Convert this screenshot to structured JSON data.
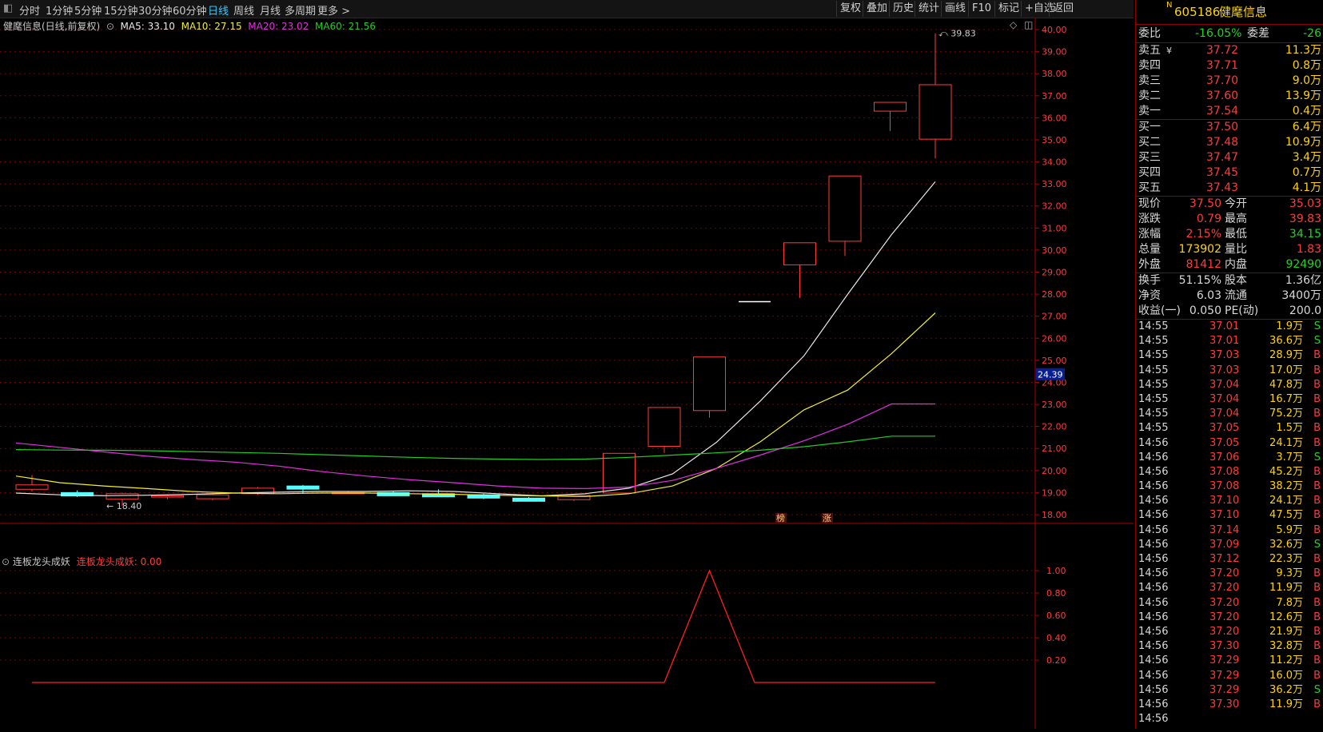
{
  "toolbar": {
    "periods": [
      "分时",
      "1分钟",
      "5分钟",
      "15分钟",
      "30分钟",
      "60分钟",
      "日线",
      "周线",
      "月线",
      "多周期",
      "更多 >"
    ],
    "active_period": "日线",
    "buttons": [
      "复权",
      "叠加",
      "历史",
      "统计",
      "画线",
      "F10",
      "标记",
      "+自选",
      "返回"
    ]
  },
  "main_legend": {
    "title": "健麾信息(日线,前复权)",
    "ma5": "MA5: 33.10",
    "ma10": "MA10: 27.15",
    "ma20": "MA20: 23.02",
    "ma60": "MA60: 21.56"
  },
  "colors": {
    "up": "#ff3b3b",
    "down": "#54ffff",
    "ma5": "#e8e8e8",
    "ma10": "#f2ee32",
    "ma20": "#e030e0",
    "ma60": "#22cc22",
    "grid": "#7a0000"
  },
  "price_axis": {
    "labels": [
      "40.00",
      "39.00",
      "38.00",
      "37.00",
      "36.00",
      "35.00",
      "34.00",
      "33.00",
      "32.00",
      "31.00",
      "30.00",
      "29.00",
      "28.00",
      "27.00",
      "26.00",
      "25.00",
      "24.00",
      "23.00",
      "22.00",
      "21.00",
      "20.00",
      "19.00",
      "18.00"
    ],
    "cursor_label": "24.39"
  },
  "candles": [
    {
      "o": 19.15,
      "c": 19.35,
      "h": 19.8,
      "l": 19.05
    },
    {
      "o": 19.0,
      "c": 18.85,
      "h": 19.1,
      "l": 18.8
    },
    {
      "o": 18.7,
      "c": 18.95,
      "h": 19.0,
      "l": 18.4
    },
    {
      "o": 18.8,
      "c": 18.85,
      "h": 18.9,
      "l": 18.7
    },
    {
      "o": 18.72,
      "c": 18.9,
      "h": 18.95,
      "l": 18.65
    },
    {
      "o": 18.95,
      "c": 19.2,
      "h": 19.25,
      "l": 18.9
    },
    {
      "o": 19.3,
      "c": 19.2,
      "h": 19.35,
      "l": 18.95
    },
    {
      "o": 19.0,
      "c": 19.0,
      "h": 19.05,
      "l": 18.95
    },
    {
      "o": 19.0,
      "c": 18.92,
      "h": 19.05,
      "l": 18.85
    },
    {
      "o": 18.95,
      "c": 18.9,
      "h": 19.15,
      "l": 18.85
    },
    {
      "o": 18.9,
      "c": 18.75,
      "h": 18.95,
      "l": 18.7
    },
    {
      "o": 18.75,
      "c": 18.72,
      "h": 18.8,
      "l": 18.65
    },
    {
      "o": 18.68,
      "c": 18.88,
      "h": 18.9,
      "l": 18.62
    },
    {
      "o": 18.98,
      "c": 20.78,
      "h": 20.78,
      "l": 18.98
    },
    {
      "o": 21.1,
      "c": 22.86,
      "h": 22.86,
      "l": 20.8
    },
    {
      "o": 22.72,
      "c": 25.15,
      "h": 25.15,
      "l": 22.4
    },
    {
      "o": 27.66,
      "c": 27.66,
      "h": 27.66,
      "l": 27.66
    },
    {
      "o": 29.33,
      "c": 30.33,
      "h": 30.33,
      "l": 27.83
    },
    {
      "o": 30.4,
      "c": 33.36,
      "h": 33.36,
      "l": 29.73
    },
    {
      "o": 36.3,
      "c": 36.7,
      "h": 36.7,
      "l": 35.4
    },
    {
      "o": 35.03,
      "c": 37.5,
      "h": 39.83,
      "l": 34.15
    }
  ],
  "ma_lines": {
    "ma5": [
      18.98,
      18.9,
      18.86,
      18.88,
      18.92,
      18.98,
      19.02,
      19.05,
      19.05,
      19.08,
      19.05,
      18.95,
      18.85,
      18.95,
      19.2,
      19.85,
      21.28,
      23.15,
      25.2,
      28.0,
      30.7,
      33.1
    ],
    "ma10": [
      19.75,
      19.45,
      19.3,
      19.18,
      19.05,
      18.98,
      18.95,
      18.98,
      18.98,
      18.95,
      18.92,
      18.88,
      18.85,
      18.82,
      18.95,
      19.3,
      20.1,
      21.3,
      22.75,
      23.65,
      25.3,
      27.15
    ],
    "ma20": [
      21.25,
      21.05,
      20.85,
      20.65,
      20.5,
      20.38,
      20.2,
      19.95,
      19.75,
      19.58,
      19.45,
      19.3,
      19.2,
      19.18,
      19.25,
      19.55,
      20.1,
      20.7,
      21.35,
      22.1,
      23.02,
      23.02
    ],
    "ma60": [
      20.95,
      20.93,
      20.92,
      20.9,
      20.86,
      20.82,
      20.78,
      20.72,
      20.66,
      20.6,
      20.55,
      20.52,
      20.5,
      20.52,
      20.6,
      20.7,
      20.8,
      20.92,
      21.08,
      21.3,
      21.56,
      21.56
    ]
  },
  "annotations": {
    "high_label": "39.83",
    "low_label": "18.40",
    "marker1": "榜",
    "marker2": "涨"
  },
  "indicator": {
    "title": "连板龙头成妖",
    "value_label": "连板龙头成妖: 0.00",
    "axis_labels": [
      "1.00",
      "0.80",
      "0.60",
      "0.40",
      "0.20"
    ],
    "series": [
      0,
      0,
      0,
      0,
      0,
      0,
      0,
      0,
      0,
      0,
      0,
      0,
      0,
      0,
      0,
      1,
      0,
      0,
      0,
      0,
      0
    ]
  },
  "quote": {
    "code": "605186",
    "name": "健麾信息",
    "badge": "N",
    "weibi_label": "委比",
    "weibi": "-16.05%",
    "weicha_label": "委差",
    "weicha": "-26",
    "asks": [
      {
        "label": "卖五",
        "mark": "¥",
        "price": "37.72",
        "vol": "11.3万"
      },
      {
        "label": "卖四",
        "mark": "",
        "price": "37.71",
        "vol": "0.8万"
      },
      {
        "label": "卖三",
        "mark": "",
        "price": "37.70",
        "vol": "9.0万"
      },
      {
        "label": "卖二",
        "mark": "",
        "price": "37.60",
        "vol": "13.9万"
      },
      {
        "label": "卖一",
        "mark": "",
        "price": "37.54",
        "vol": "0.4万"
      }
    ],
    "bids": [
      {
        "label": "买一",
        "price": "37.50",
        "vol": "6.4万"
      },
      {
        "label": "买二",
        "price": "37.48",
        "vol": "10.9万"
      },
      {
        "label": "买三",
        "price": "37.47",
        "vol": "3.4万"
      },
      {
        "label": "买四",
        "price": "37.45",
        "vol": "0.7万"
      },
      {
        "label": "买五",
        "price": "37.43",
        "vol": "4.1万"
      }
    ],
    "stats1": [
      {
        "l1": "现价",
        "v1": "37.50",
        "l2": "今开",
        "v2": "35.03"
      },
      {
        "l1": "涨跌",
        "v1": "0.79",
        "l2": "最高",
        "v2": "39.83"
      },
      {
        "l1": "涨幅",
        "v1": "2.15%",
        "l2": "最低",
        "v2": "34.15"
      },
      {
        "l1": "总量",
        "v1": "173902",
        "l2": "量比",
        "v2": "1.83"
      },
      {
        "l1": "外盘",
        "v1": "81412",
        "l2": "内盘",
        "v2": "92490"
      }
    ],
    "stats2": [
      {
        "l1": "换手",
        "v1": "51.15%",
        "l2": "股本",
        "v2": "1.36亿"
      },
      {
        "l1": "净资",
        "v1": "6.03",
        "l2": "流通",
        "v2": "3400万"
      },
      {
        "l1": "收益(一)",
        "v1": "0.050",
        "l2": "PE(动)",
        "v2": "200.0"
      }
    ],
    "ticks": [
      {
        "t": "14:55",
        "p": "37.01",
        "v": "1.9万",
        "s": "S"
      },
      {
        "t": "14:55",
        "p": "37.01",
        "v": "36.6万",
        "s": "S"
      },
      {
        "t": "14:55",
        "p": "37.03",
        "v": "28.9万",
        "s": "B"
      },
      {
        "t": "14:55",
        "p": "37.03",
        "v": "17.0万",
        "s": "B"
      },
      {
        "t": "14:55",
        "p": "37.04",
        "v": "47.8万",
        "s": "B"
      },
      {
        "t": "14:55",
        "p": "37.04",
        "v": "16.7万",
        "s": "B"
      },
      {
        "t": "14:55",
        "p": "37.04",
        "v": "75.2万",
        "s": "B"
      },
      {
        "t": "14:55",
        "p": "37.05",
        "v": "1.5万",
        "s": "B"
      },
      {
        "t": "14:56",
        "p": "37.05",
        "v": "24.1万",
        "s": "B"
      },
      {
        "t": "14:56",
        "p": "37.06",
        "v": "3.7万",
        "s": "S"
      },
      {
        "t": "14:56",
        "p": "37.08",
        "v": "45.2万",
        "s": "B"
      },
      {
        "t": "14:56",
        "p": "37.08",
        "v": "38.2万",
        "s": "B"
      },
      {
        "t": "14:56",
        "p": "37.10",
        "v": "24.1万",
        "s": "B"
      },
      {
        "t": "14:56",
        "p": "37.10",
        "v": "47.5万",
        "s": "B"
      },
      {
        "t": "14:56",
        "p": "37.14",
        "v": "5.9万",
        "s": "B"
      },
      {
        "t": "14:56",
        "p": "37.09",
        "v": "32.6万",
        "s": "S"
      },
      {
        "t": "14:56",
        "p": "37.12",
        "v": "22.3万",
        "s": "B"
      },
      {
        "t": "14:56",
        "p": "37.20",
        "v": "9.3万",
        "s": "B"
      },
      {
        "t": "14:56",
        "p": "37.20",
        "v": "11.9万",
        "s": "B"
      },
      {
        "t": "14:56",
        "p": "37.20",
        "v": "7.8万",
        "s": "B"
      },
      {
        "t": "14:56",
        "p": "37.20",
        "v": "12.6万",
        "s": "B"
      },
      {
        "t": "14:56",
        "p": "37.20",
        "v": "21.9万",
        "s": "B"
      },
      {
        "t": "14:56",
        "p": "37.30",
        "v": "32.8万",
        "s": "B"
      },
      {
        "t": "14:56",
        "p": "37.29",
        "v": "11.2万",
        "s": "B"
      },
      {
        "t": "14:56",
        "p": "37.29",
        "v": "16.0万",
        "s": "B"
      },
      {
        "t": "14:56",
        "p": "37.29",
        "v": "36.2万",
        "s": "S"
      },
      {
        "t": "14:56",
        "p": "37.30",
        "v": "11.9万",
        "s": "B"
      },
      {
        "t": "14:56",
        "p": "",
        "v": "",
        "s": ""
      }
    ]
  }
}
